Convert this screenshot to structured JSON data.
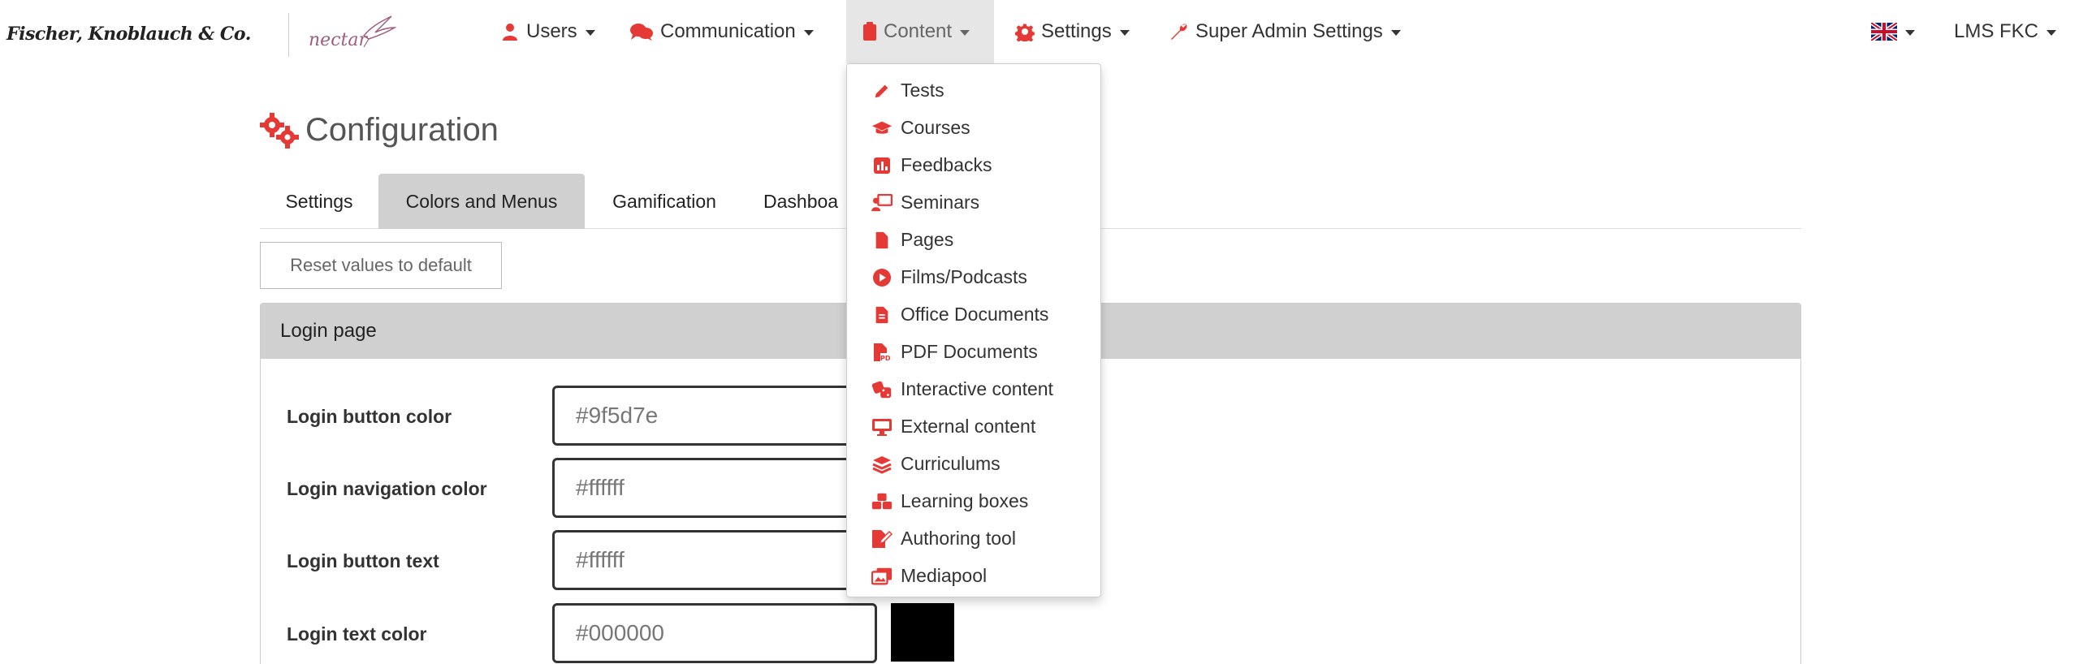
{
  "brand": {
    "name": "Fischer, Knoblauch & Co.",
    "sub_logo": "nectar"
  },
  "nav": {
    "users": "Users",
    "communication": "Communication",
    "content": "Content",
    "settings": "Settings",
    "super_admin": "Super Admin Settings",
    "org": "LMS FKC"
  },
  "page": {
    "title": "Configuration"
  },
  "tabs": [
    "Settings",
    "Colors and Menus",
    "Gamification",
    "Dashboa"
  ],
  "reset_label": "Reset values to default",
  "panel": {
    "title": "Login page",
    "fields": [
      {
        "label": "Login button color",
        "value": "#9f5d7e"
      },
      {
        "label": "Login navigation color",
        "value": "#ffffff"
      },
      {
        "label": "Login button text",
        "value": "#ffffff"
      },
      {
        "label": "Login text color",
        "value": "#000000"
      }
    ]
  },
  "content_menu": [
    "Tests",
    "Courses",
    "Feedbacks",
    "Seminars",
    "Pages",
    "Films/Podcasts",
    "Office Documents",
    "PDF Documents",
    "Interactive content",
    "External content",
    "Curriculums",
    "Learning boxes",
    "Authoring tool",
    "Mediapool"
  ],
  "colors": {
    "accent": "#e53935",
    "active_tab": "#d0d0d0",
    "panel_head": "#d0d0d0"
  }
}
